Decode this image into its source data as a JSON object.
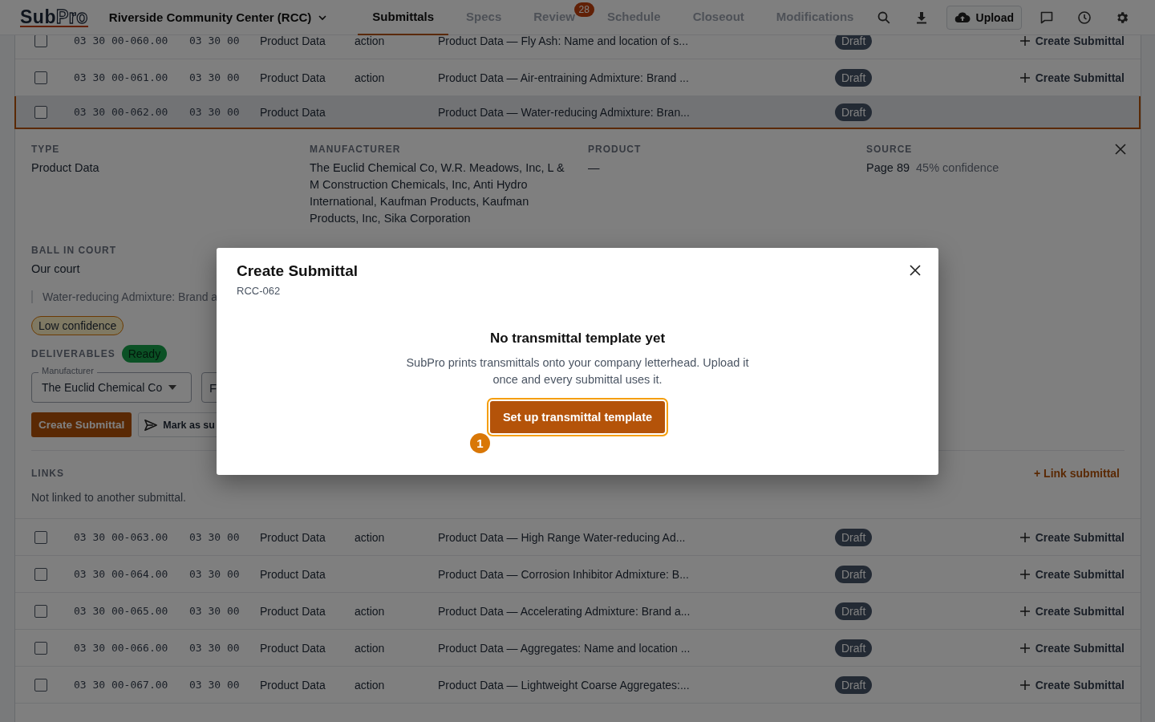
{
  "app": {
    "logo_left": "Sub",
    "logo_right": "Pro",
    "project": "Riverside Community Center (RCC)"
  },
  "tabs": [
    {
      "label": "Submittals",
      "selected": true
    },
    {
      "label": "Specs",
      "selected": false
    },
    {
      "label": "Review",
      "selected": false,
      "badge": "28"
    },
    {
      "label": "Schedule",
      "selected": false
    },
    {
      "label": "Closeout",
      "selected": false
    },
    {
      "label": "Modifications",
      "selected": false
    }
  ],
  "toolbar": {
    "upload": "Upload"
  },
  "rows": [
    {
      "checked": false,
      "selected": false,
      "code": "03 30 00-060.00",
      "spec": "03 30 00",
      "type": "Product Data",
      "action": "action",
      "title": "Product Data — Fly Ash: Name and location of s...",
      "status": "Draft",
      "create": "Create Submittal"
    },
    {
      "checked": false,
      "selected": false,
      "code": "03 30 00-061.00",
      "spec": "03 30 00",
      "type": "Product Data",
      "action": "action",
      "title": "Product Data — Air-entraining Admixture: Brand ...",
      "status": "Draft",
      "create": "Create Submittal"
    },
    {
      "checked": false,
      "selected": true,
      "code": "03 30 00-062.00",
      "spec": "03 30 00",
      "type": "Product Data",
      "title": "Product Data — Water-reducing Admixture: Bran...",
      "status": "Draft"
    },
    {
      "checked": false,
      "selected": false,
      "code": "03 30 00-063.00",
      "spec": "03 30 00",
      "type": "Product Data",
      "action": "action",
      "title": "Product Data — High Range Water-reducing Ad...",
      "status": "Draft",
      "create": "Create Submittal"
    },
    {
      "checked": false,
      "selected": false,
      "code": "03 30 00-064.00",
      "spec": "03 30 00",
      "type": "Product Data",
      "title": "Product Data — Corrosion Inhibitor Admixture: B...",
      "status": "Draft",
      "create": "Create Submittal"
    },
    {
      "checked": false,
      "selected": false,
      "code": "03 30 00-065.00",
      "spec": "03 30 00",
      "type": "Product Data",
      "action": "action",
      "title": "Product Data — Accelerating Admixture: Brand a...",
      "status": "Draft",
      "create": "Create Submittal"
    },
    {
      "checked": false,
      "selected": false,
      "code": "03 30 00-066.00",
      "spec": "03 30 00",
      "type": "Product Data",
      "action": "action",
      "title": "Product Data — Aggregates: Name and location ...",
      "status": "Draft",
      "create": "Create Submittal"
    },
    {
      "checked": false,
      "selected": false,
      "code": "03 30 00-067.00",
      "spec": "03 30 00",
      "type": "Product Data",
      "action": "action",
      "title": "Product Data — Lightweight Coarse Aggregates:...",
      "status": "Draft",
      "create": "Create Submittal"
    }
  ],
  "detail": {
    "fields": [
      {
        "label": "TYPE",
        "value": "Product Data"
      },
      {
        "label": "MANUFACTURER",
        "value": "The Euclid Chemical Co, W.R. Meadows, Inc, L & M Construction Chemicals, Inc, Anti Hydro International, Kaufman Products, Kaufman Products, Inc, Sika Corporation"
      },
      {
        "label": "PRODUCT",
        "value": "—"
      },
      {
        "label": "SOURCE",
        "value": "Page 89",
        "note": "45% confidence"
      }
    ],
    "ball_in_court": {
      "label": "BALL IN COURT",
      "value": "Our court"
    },
    "quote": "Water-reducing Admixture: Brand a",
    "confidence": "Low confidence",
    "deliverables": {
      "label": "DELIVERABLES",
      "status": "Ready"
    },
    "manufacturer_field": {
      "label": "Manufacturer",
      "value": "The Euclid Chemical Co"
    },
    "second_field": {
      "value": "F"
    },
    "create_button": "Create Submittal",
    "mark_button": "Mark as su",
    "links": {
      "label": "LINKS",
      "action": "+ Link submittal",
      "empty": "Not linked to another submittal."
    }
  },
  "modal": {
    "title": "Create Submittal",
    "subtitle": "RCC-062",
    "heading": "No transmittal template yet",
    "description": "SubPro prints transmittals onto your company letterhead. Upload it once and every submittal uses it.",
    "button": "Set up transmittal template",
    "step": "1"
  }
}
